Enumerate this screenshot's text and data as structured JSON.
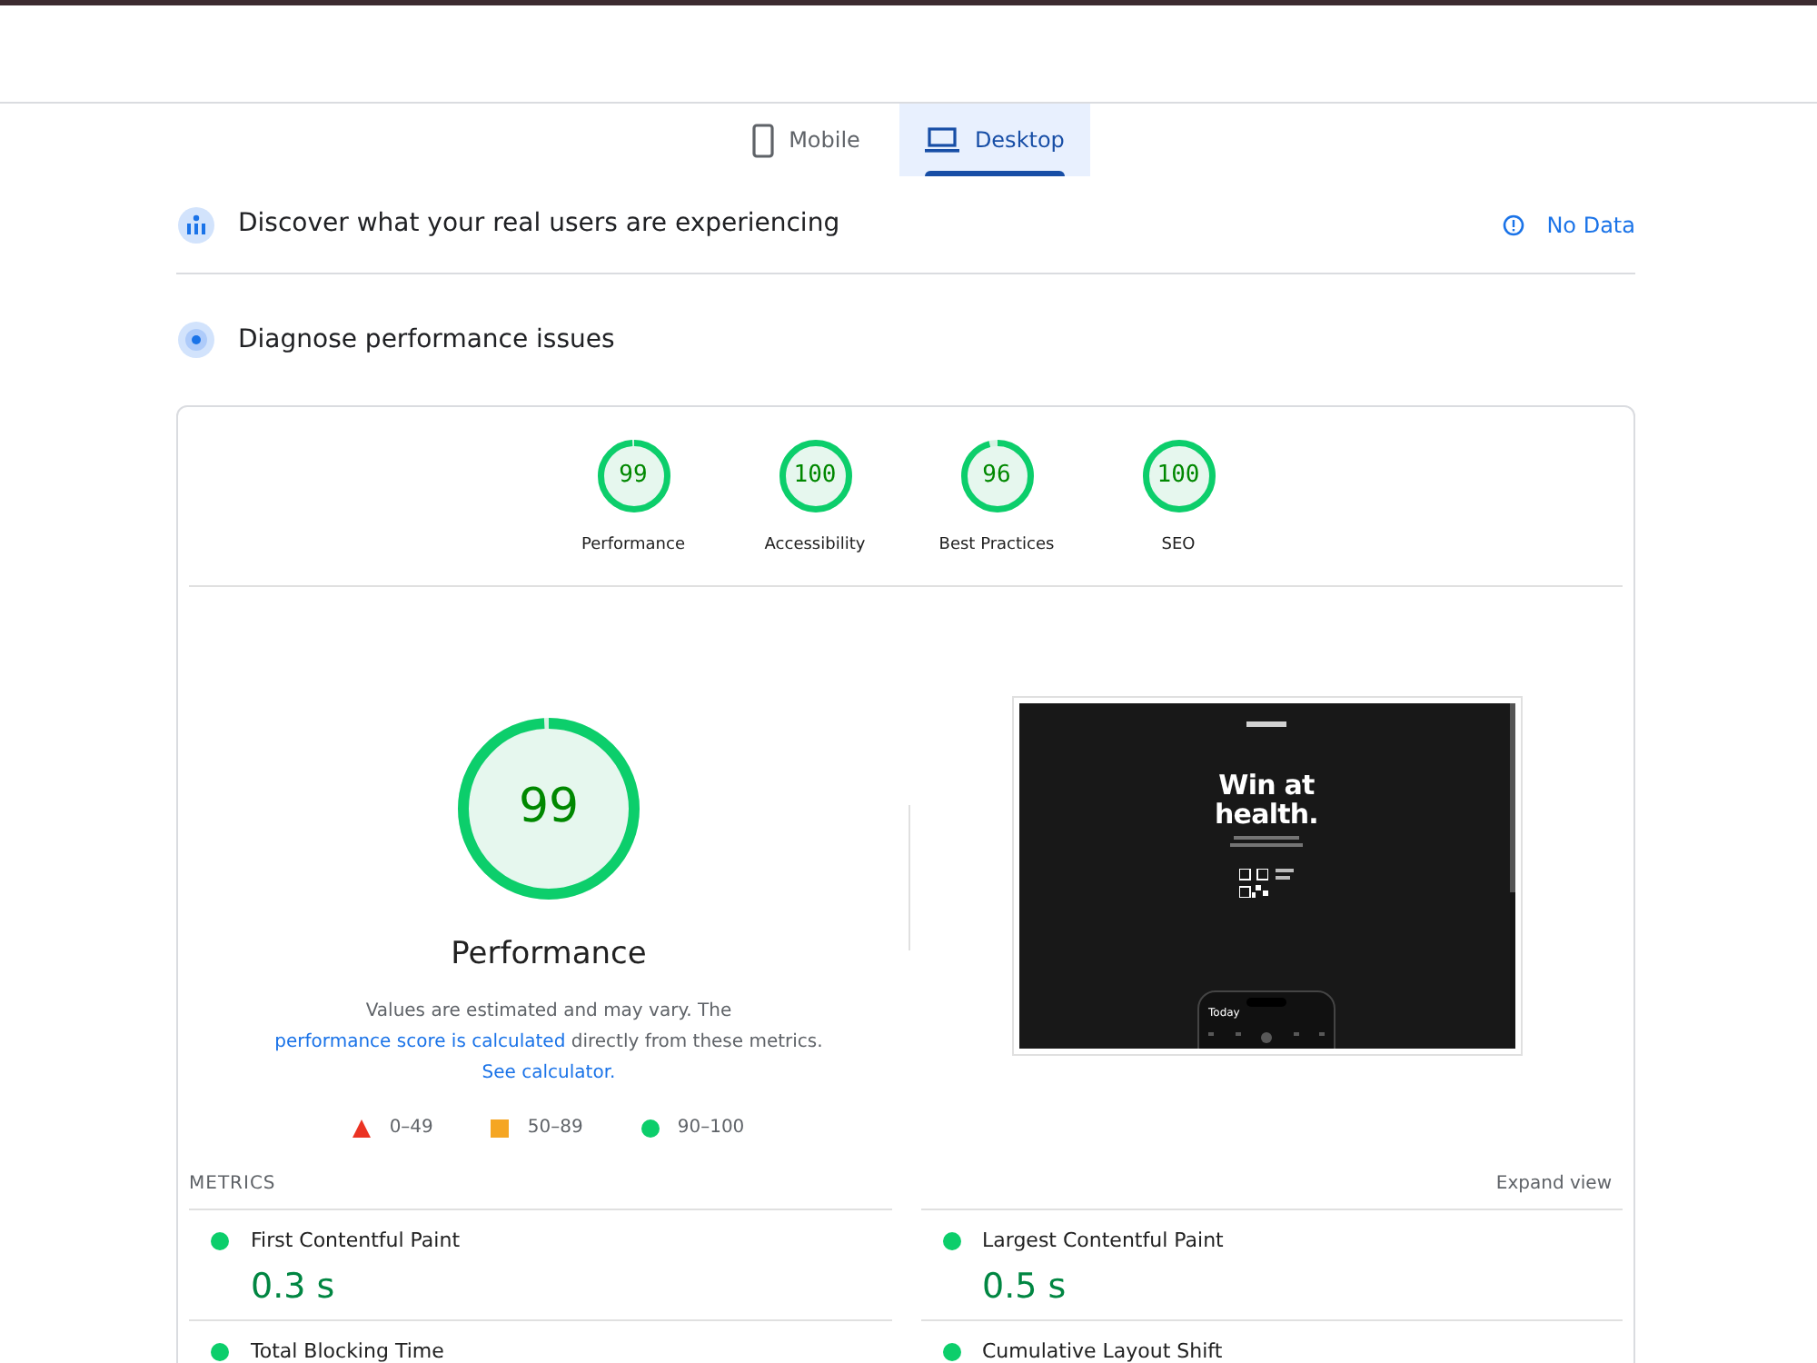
{
  "tabs": [
    {
      "label": "Mobile",
      "kind": "phone",
      "selected": false
    },
    {
      "label": "Desktop",
      "kind": "laptop",
      "selected": true
    }
  ],
  "field_data": {
    "title": "Discover what your real users are experiencing",
    "status": "No Data"
  },
  "diagnose": {
    "title": "Diagnose performance issues"
  },
  "categories": [
    {
      "score": "99",
      "label": "Performance",
      "level": 0.99
    },
    {
      "score": "100",
      "label": "Accessibility",
      "level": 1
    },
    {
      "score": "96",
      "label": "Best Practices",
      "level": 0.96
    },
    {
      "score": "100",
      "label": "SEO",
      "level": 1
    }
  ],
  "main_gauge": {
    "score": "99",
    "label": "Performance",
    "level": 0.99
  },
  "description": [
    {
      "kind": "text",
      "text": "Values are estimated and may vary. The"
    },
    {
      "kind": "link",
      "text": "performance score is calculated"
    },
    {
      "kind": "text",
      "text": "directly from these metrics."
    },
    {
      "kind": "link",
      "text": "See calculator."
    }
  ],
  "legend": [
    {
      "kind": "fail",
      "range": "0–49",
      "color": "#eb3323"
    },
    {
      "kind": "average",
      "range": "50–89",
      "color": "#f5a623"
    },
    {
      "kind": "pass",
      "range": "90–100",
      "color": "#0cce6b"
    }
  ],
  "screenshot": {
    "headline_1": "Win at",
    "headline_2": "health.",
    "app_title": "Today"
  },
  "metrics_title": "METRICS",
  "expand": "Expand view",
  "metrics": [
    {
      "name": "First Contentful Paint",
      "value": "0.3 s",
      "color": "#0cce6b"
    },
    {
      "name": "Largest Contentful Paint",
      "value": "0.5 s",
      "color": "#0cce6b"
    },
    {
      "name": "Total Blocking Time",
      "color": "#0cce6b"
    },
    {
      "name": "Cumulative Layout Shift",
      "color": "#0cce6b"
    }
  ]
}
